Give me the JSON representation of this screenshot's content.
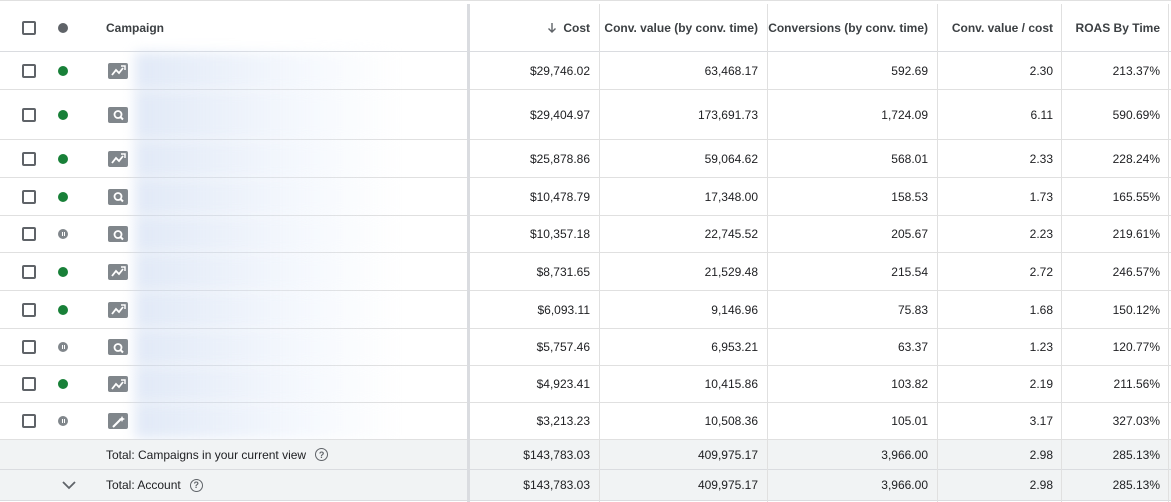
{
  "header": {
    "campaign": "Campaign",
    "cost": "Cost",
    "conv_value": "Conv. value (by conv. time)",
    "conversions": "Conversions (by conv. time)",
    "value_cost": "Conv. value / cost",
    "roas": "ROAS By Time",
    "sort_icon": "arrow-down-icon"
  },
  "rows": [
    {
      "status": "enabled",
      "type": "performance-max",
      "cost": "$29,746.02",
      "conv_value": "63,468.17",
      "conversions": "592.69",
      "value_cost": "2.30",
      "roas": "213.37%"
    },
    {
      "status": "enabled",
      "type": "search",
      "cost": "$29,404.97",
      "conv_value": "173,691.73",
      "conversions": "1,724.09",
      "value_cost": "6.11",
      "roas": "590.69%"
    },
    {
      "status": "enabled",
      "type": "performance-max",
      "cost": "$25,878.86",
      "conv_value": "59,064.62",
      "conversions": "568.01",
      "value_cost": "2.33",
      "roas": "228.24%"
    },
    {
      "status": "enabled",
      "type": "search",
      "cost": "$10,478.79",
      "conv_value": "17,348.00",
      "conversions": "158.53",
      "value_cost": "1.73",
      "roas": "165.55%"
    },
    {
      "status": "paused",
      "type": "search",
      "cost": "$10,357.18",
      "conv_value": "22,745.52",
      "conversions": "205.67",
      "value_cost": "2.23",
      "roas": "219.61%"
    },
    {
      "status": "enabled",
      "type": "performance-max",
      "cost": "$8,731.65",
      "conv_value": "21,529.48",
      "conversions": "215.54",
      "value_cost": "2.72",
      "roas": "246.57%"
    },
    {
      "status": "enabled",
      "type": "performance-max",
      "cost": "$6,093.11",
      "conv_value": "9,146.96",
      "conversions": "75.83",
      "value_cost": "1.68",
      "roas": "150.12%"
    },
    {
      "status": "paused",
      "type": "search",
      "cost": "$5,757.46",
      "conv_value": "6,953.21",
      "conversions": "63.37",
      "value_cost": "1.23",
      "roas": "120.77%"
    },
    {
      "status": "enabled",
      "type": "performance-max",
      "cost": "$4,923.41",
      "conv_value": "10,415.86",
      "conversions": "103.82",
      "value_cost": "2.19",
      "roas": "211.56%"
    },
    {
      "status": "paused",
      "type": "smart",
      "cost": "$3,213.23",
      "conv_value": "10,508.36",
      "conversions": "105.01",
      "value_cost": "3.17",
      "roas": "327.03%"
    }
  ],
  "totals": [
    {
      "label": "Total: Campaigns in your current view",
      "cost": "$143,783.03",
      "conv_value": "409,975.17",
      "conversions": "3,966.00",
      "value_cost": "2.98",
      "roas": "285.13%"
    },
    {
      "label": "Total: Account",
      "cost": "$143,783.03",
      "conv_value": "409,975.17",
      "conversions": "3,966.00",
      "value_cost": "2.98",
      "roas": "285.13%"
    }
  ],
  "help_glyph": "?",
  "colors": {
    "enabled": "#188038",
    "paused": "#80868b",
    "total_bg": "#f1f3f4"
  }
}
